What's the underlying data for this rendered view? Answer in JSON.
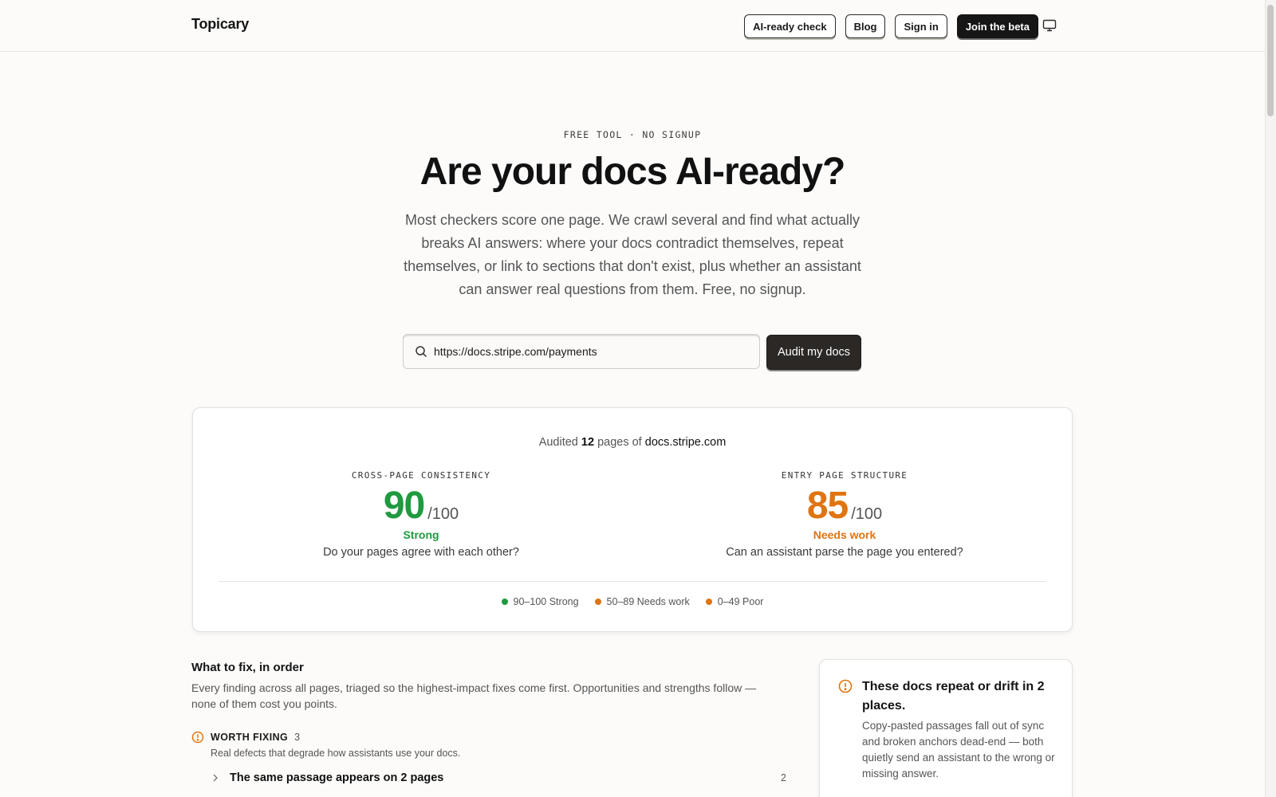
{
  "header": {
    "brand": "Topicary",
    "nav": {
      "ai_ready_check": "AI-ready check",
      "blog": "Blog",
      "sign_in": "Sign in",
      "join_beta": "Join the beta"
    },
    "display_toggle_icon": "monitor-icon"
  },
  "hero": {
    "eyebrow": "FREE TOOL · NO SIGNUP",
    "title": "Are your docs AI-ready?",
    "subtitle": "Most checkers score one page. We crawl several and find what actually breaks AI answers: where your docs contradict themselves, repeat themselves, or link to sections that don't exist, plus whether an assistant can answer real questions from them. Free, no signup."
  },
  "search": {
    "icon": "search-icon",
    "value": "https://docs.stripe.com/payments",
    "button": "Audit my docs"
  },
  "results": {
    "audited_prefix": "Audited",
    "pages_count": "12",
    "audited_mid": "pages of",
    "domain": "docs.stripe.com",
    "metrics": [
      {
        "label": "CROSS-PAGE CONSISTENCY",
        "score": "90",
        "max": "/100",
        "verdict": "Strong",
        "question": "Do your pages agree with each other?",
        "color": "#1f9a3f"
      },
      {
        "label": "ENTRY PAGE STRUCTURE",
        "score": "85",
        "max": "/100",
        "verdict": "Needs work",
        "question": "Can an assistant parse the page you entered?",
        "color": "#e07410"
      }
    ],
    "legend": [
      {
        "label": "90–100 Strong",
        "color": "#1f9a3f"
      },
      {
        "label": "50–89 Needs work",
        "color": "#e07410"
      },
      {
        "label": "0–49 Poor",
        "color": "#e07410"
      }
    ]
  },
  "fixes": {
    "title": "What to fix, in order",
    "description": "Every finding across all pages, triaged so the highest-impact fixes come first. Opportunities and strengths follow — none of them cost you points.",
    "group": {
      "icon": "alert-circle-icon",
      "label": "WORTH FIXING",
      "count": "3",
      "description": "Real defects that degrade how assistants use your docs.",
      "items": [
        {
          "title": "The same passage appears on 2 pages",
          "count": "2"
        }
      ]
    }
  },
  "side_card": {
    "icon": "alert-circle-icon",
    "title": "These docs repeat or drift in 2 places.",
    "body": "Copy-pasted passages fall out of sync and broken anchors dead-end — both quietly send an assistant to the wrong or missing answer."
  },
  "colors": {
    "strong": "#1f9a3f",
    "warn": "#e07410",
    "dark": "#161616"
  }
}
